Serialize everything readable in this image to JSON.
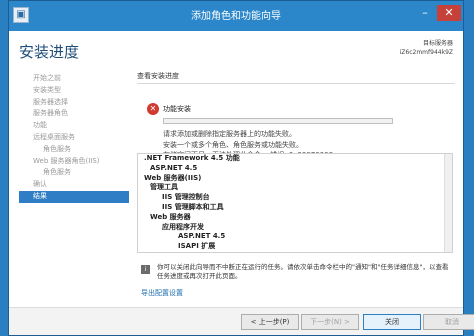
{
  "window": {
    "title": "添加角色和功能向导",
    "minimize_glyph": "–",
    "close_glyph": "✕"
  },
  "header": {
    "page_title": "安装进度",
    "target_label": "目标服务器",
    "target_server": "iZ6c2mmf944k9Z"
  },
  "sidebar": {
    "items": [
      {
        "label": "开始之前",
        "active": false,
        "sub": false
      },
      {
        "label": "安装类型",
        "active": false,
        "sub": false
      },
      {
        "label": "服务器选择",
        "active": false,
        "sub": false
      },
      {
        "label": "服务器角色",
        "active": false,
        "sub": false
      },
      {
        "label": "功能",
        "active": false,
        "sub": false
      },
      {
        "label": "远程桌面服务",
        "active": false,
        "sub": false
      },
      {
        "label": "角色服务",
        "active": false,
        "sub": true
      },
      {
        "label": "Web 服务器角色(IIS)",
        "active": false,
        "sub": false
      },
      {
        "label": "角色服务",
        "active": false,
        "sub": true
      },
      {
        "label": "确认",
        "active": false,
        "sub": false
      },
      {
        "label": "结果",
        "active": true,
        "sub": false
      }
    ]
  },
  "progress": {
    "section_label": "查看安装进度",
    "status_title": "功能安装",
    "bar_fraction": 0.0,
    "line1": "请求添加或删除指定服务器上的功能失败。",
    "line2": "安装一个或多个角色、角色服务或功能失败。",
    "line3": "存储空间不足，无法处理此命令。 错误: 0x80070008"
  },
  "results": {
    "rows": [
      {
        "text": ".NET Framework 4.5 功能",
        "level": 0
      },
      {
        "text": "ASP.NET 4.5",
        "level": 1
      },
      {
        "text": "Web 服务器(IIS)",
        "level": 0
      },
      {
        "text": "管理工具",
        "level": 1
      },
      {
        "text": "IIS 管理控制台",
        "level": 2
      },
      {
        "text": "IIS 管理脚本和工具",
        "level": 2
      },
      {
        "text": "Web 服务器",
        "level": 1
      },
      {
        "text": "应用程序开发",
        "level": 2
      },
      {
        "text": "ASP.NET 4.5",
        "level": 3
      },
      {
        "text": "ISAPI 扩展",
        "level": 4
      }
    ]
  },
  "info": {
    "icon_glyph": "i",
    "text": "你可以关闭此向导而不中断正在运行的任务。请依次单击命令栏中的\"通知\"和\"任务详细信息\"，以查看任务进度或再次打开此页面。"
  },
  "export_link": "导出配置设置",
  "footer": {
    "prev": "< 上一步(P)",
    "next": "下一步(N) >",
    "close": "关闭",
    "cancel": "取消"
  }
}
